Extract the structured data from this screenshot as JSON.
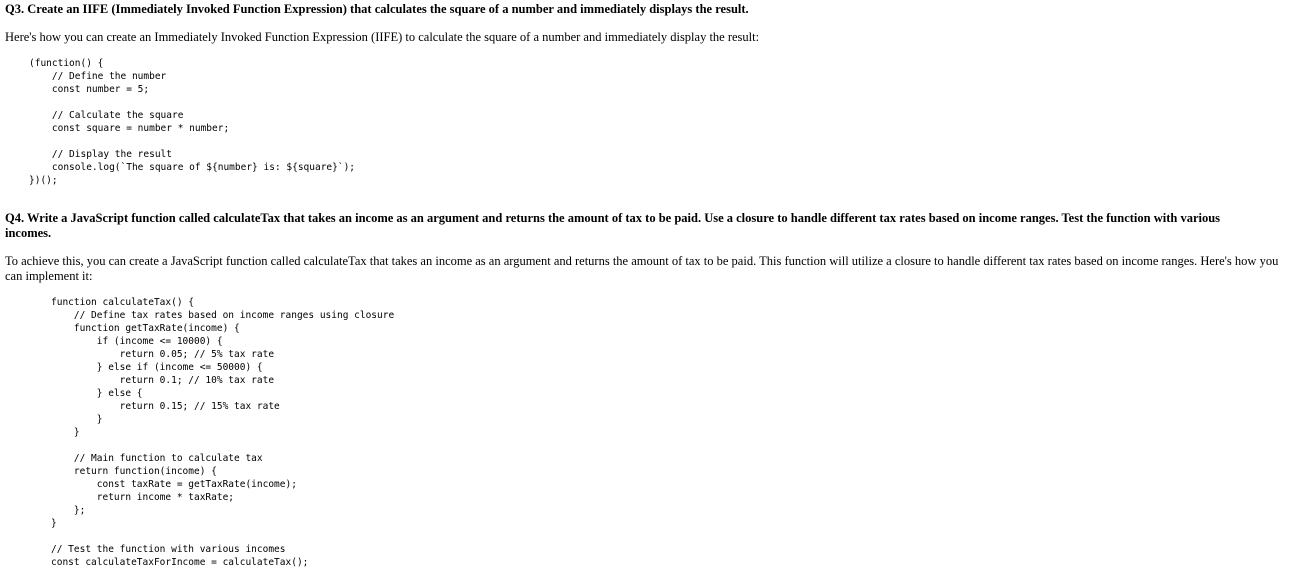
{
  "q3": {
    "title": "Q3. Create an IIFE (Immediately Invoked Function Expression) that calculates the square of a number and immediately displays the result.",
    "intro": "Here's how you can create an Immediately Invoked Function Expression (IIFE) to calculate the square of a number and immediately display the result:",
    "code": "(function() {\n    // Define the number\n    const number = 5;\n\n    // Calculate the square\n    const square = number * number;\n\n    // Display the result\n    console.log(`The square of ${number} is: ${square}`);\n})();"
  },
  "q4": {
    "title": "Q4. Write a JavaScript function called calculateTax that takes an income as an argument and returns the amount of tax to be paid. Use a closure to handle different tax rates based on income ranges. Test the function with various incomes.",
    "intro": "To achieve this, you can create a JavaScript function called calculateTax that takes an income as an argument and returns the amount of tax to be paid. This function will utilize a closure to handle different tax rates based on income ranges. Here's how you can implement it:",
    "code": "function calculateTax() {\n    // Define tax rates based on income ranges using closure\n    function getTaxRate(income) {\n        if (income <= 10000) {\n            return 0.05; // 5% tax rate\n        } else if (income <= 50000) {\n            return 0.1; // 10% tax rate\n        } else {\n            return 0.15; // 15% tax rate\n        }\n    }\n\n    // Main function to calculate tax\n    return function(income) {\n        const taxRate = getTaxRate(income);\n        return income * taxRate;\n    };\n}\n\n// Test the function with various incomes\nconst calculateTaxForIncome = calculateTax();"
  }
}
